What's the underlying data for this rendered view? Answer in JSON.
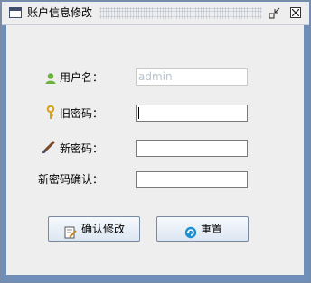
{
  "window": {
    "title": "账户信息修改",
    "icons": {
      "window": "window-icon",
      "iconify": "iconify-icon",
      "close": "close-icon"
    }
  },
  "form": {
    "username": {
      "label": "用户名：",
      "value": "admin",
      "icon": "user-icon"
    },
    "old_password": {
      "label": "旧密码：",
      "value": "",
      "icon": "key-icon"
    },
    "new_password": {
      "label": "新密码：",
      "value": "",
      "icon": "brush-icon"
    },
    "confirm_password": {
      "label": "新密码确认：",
      "value": ""
    }
  },
  "buttons": {
    "confirm": {
      "label": "确认修改",
      "icon": "edit-icon"
    },
    "reset": {
      "label": "重置",
      "icon": "reset-icon"
    }
  },
  "colors": {
    "window_border": "#6f8fb8",
    "panel": "#eeeeee",
    "button_border": "#7a8aa3"
  }
}
